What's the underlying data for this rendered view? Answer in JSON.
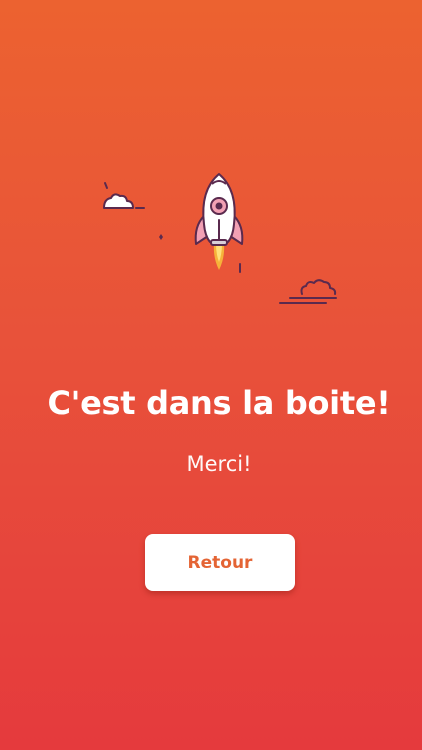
{
  "screen": {
    "title": "C'est dans la boite!",
    "message": "Merci!",
    "back_button_label": "Retour"
  },
  "colors": {
    "gradient_top": "#ec6230",
    "gradient_bottom": "#e53a3d",
    "button_background": "#ffffff",
    "button_text": "#e46434",
    "text": "#ffffff",
    "outline": "#5a2a4e"
  },
  "icons": [
    "rocket-icon",
    "cloud-icon",
    "sparkle-icon"
  ]
}
